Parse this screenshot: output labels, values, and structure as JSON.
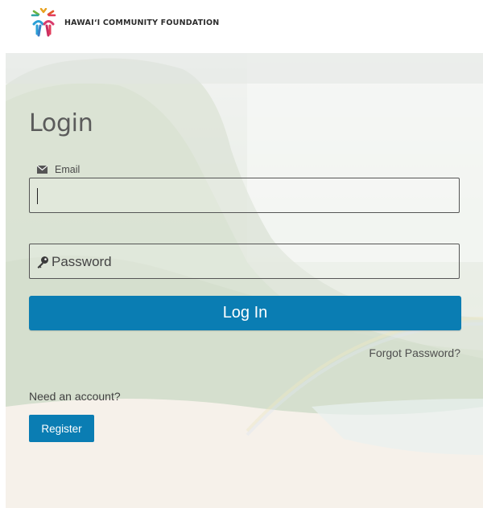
{
  "header": {
    "org_name": "HAWAI‘I COMMUNITY FOUNDATION",
    "logo_icon": "hcf-logo-icon"
  },
  "login": {
    "title": "Login",
    "email_label": "Email",
    "email_icon": "envelope-icon",
    "email_value": "",
    "password_placeholder": "Password",
    "password_icon": "key-icon",
    "login_button": "Log In",
    "forgot_password": "Forgot Password?",
    "need_account": "Need an account?",
    "register_button": "Register"
  },
  "colors": {
    "primary": "#0a7db3",
    "text": "#4a4a4a"
  }
}
